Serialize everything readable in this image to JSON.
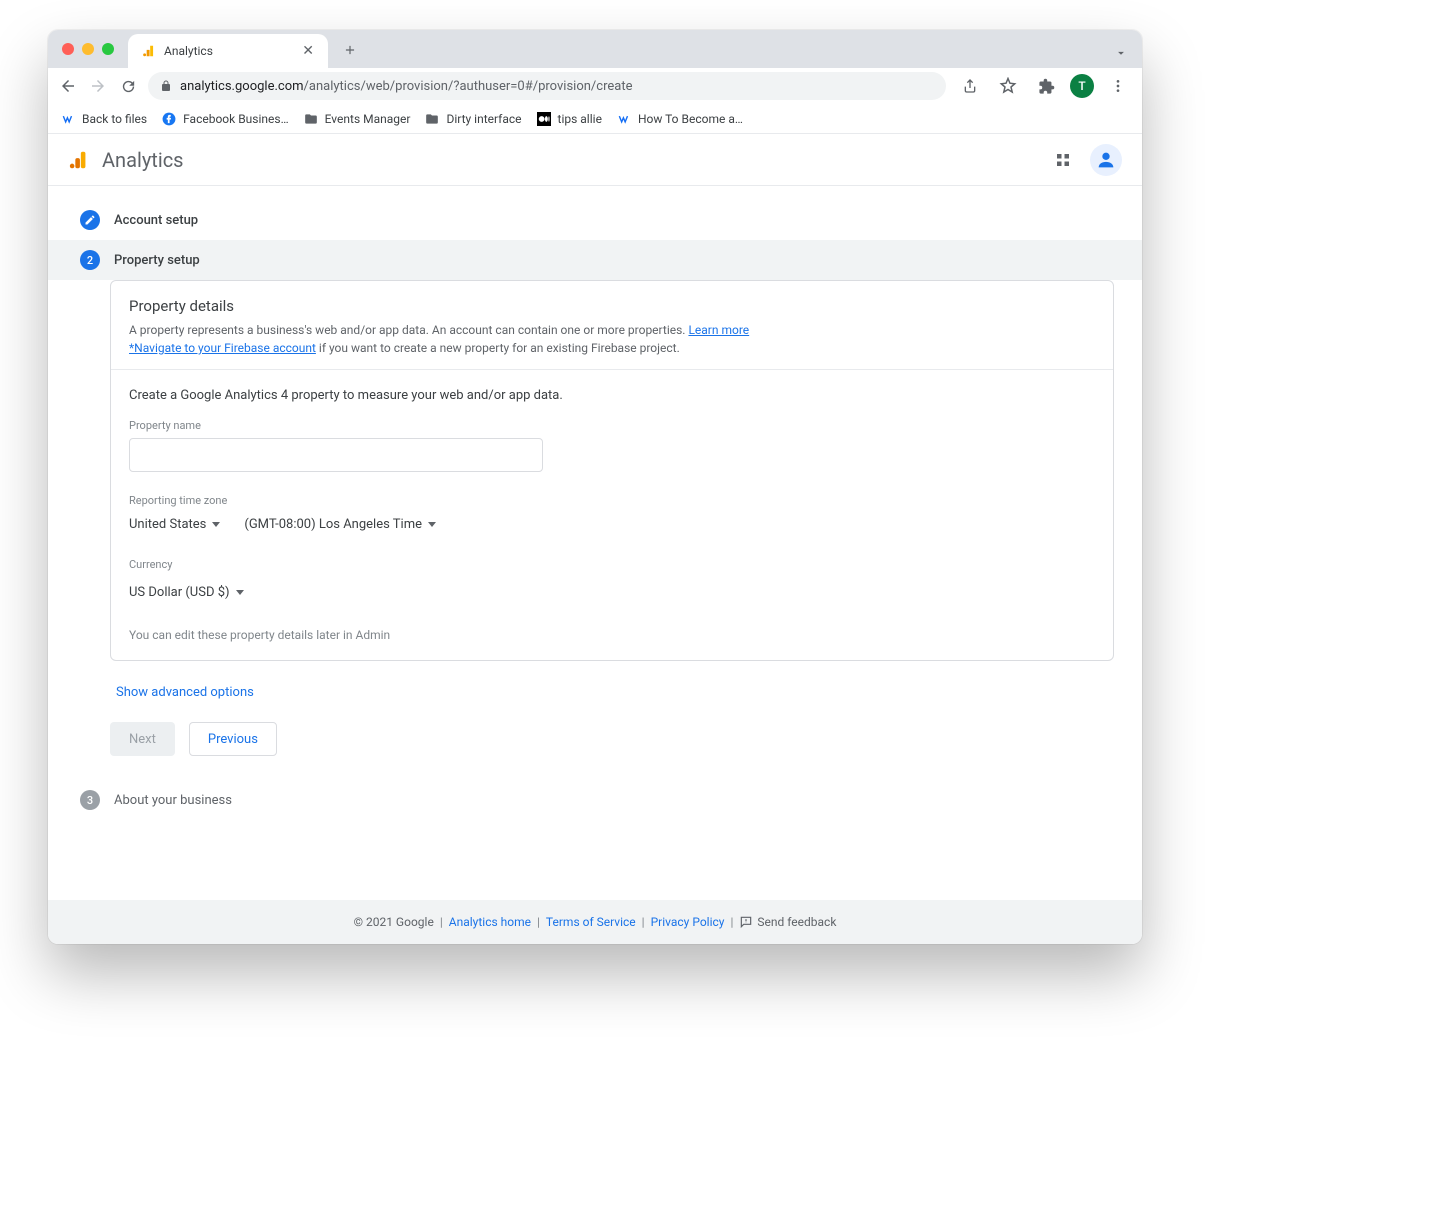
{
  "browser": {
    "tab_title": "Analytics",
    "url_host": "analytics.google.com",
    "url_path": "/analytics/web/provision/?authuser=0#/provision/create",
    "bookmarks": [
      "Back to files",
      "Facebook Busines…",
      "Events Manager",
      "Dirty interface",
      "tips allie",
      "How To Become a…"
    ],
    "avatar_letter": "T"
  },
  "header": {
    "title": "Analytics"
  },
  "steps": {
    "s1_label": "Account setup",
    "s2_label": "Property setup",
    "s2_num": "2",
    "s3_label": "About your business",
    "s3_num": "3"
  },
  "card": {
    "title": "Property details",
    "desc_a": "A property represents a business's web and/or app data. An account can contain one or more properties. ",
    "learn_more": "Learn more",
    "firebase_link": "*Navigate to your Firebase account",
    "desc_b": " if you want to create a new property for an existing Firebase project.",
    "lead": "Create a Google Analytics 4 property to measure your web and/or app data.",
    "property_name_label": "Property name",
    "property_name_value": "",
    "tz_label": "Reporting time zone",
    "tz_country": "United States",
    "tz_offset": "(GMT-08:00) Los Angeles Time",
    "currency_label": "Currency",
    "currency_value": "US Dollar (USD $)",
    "hint": "You can edit these property details later in Admin"
  },
  "advanced": "Show advanced options",
  "buttons": {
    "next": "Next",
    "previous": "Previous"
  },
  "footer": {
    "copyright": "© 2021 Google",
    "home": "Analytics home",
    "tos": "Terms of Service",
    "privacy": "Privacy Policy",
    "feedback": "Send feedback"
  }
}
